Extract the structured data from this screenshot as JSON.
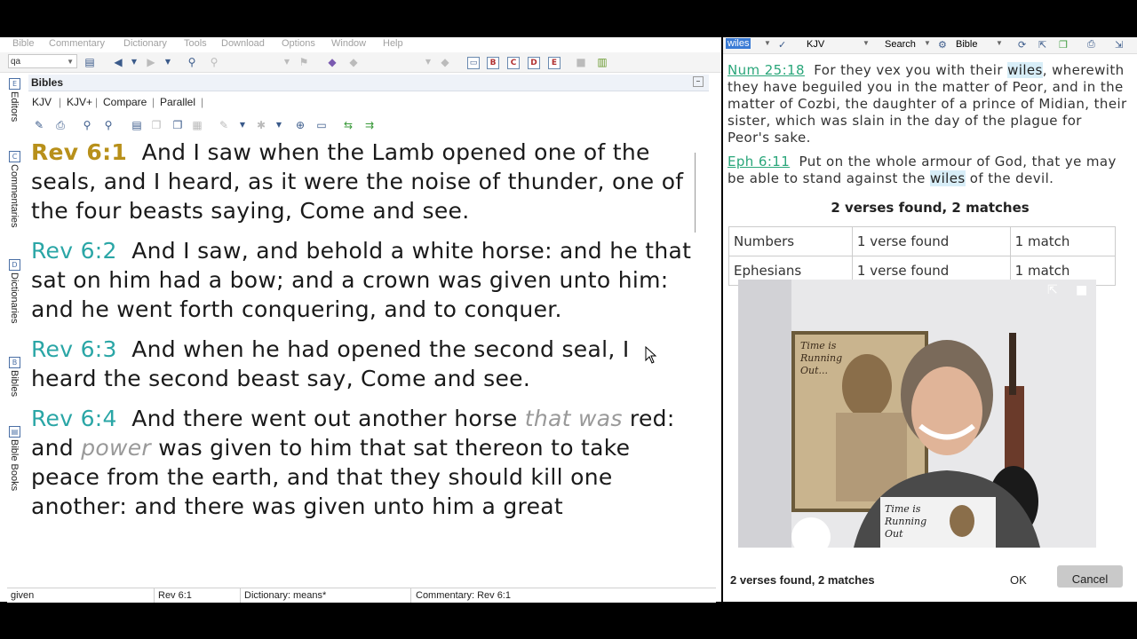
{
  "menu": [
    "Bible",
    "Commentary",
    "Dictionary",
    "Tools",
    "Download",
    "Options",
    "Window",
    "Help"
  ],
  "toolbar": {
    "module_combo": "qa"
  },
  "sidebar_tabs": [
    "Editors",
    "Commentaries",
    "Dictionaries",
    "Bibles",
    "Bible Books"
  ],
  "panel": {
    "title": "Bibles"
  },
  "tabs": [
    "KJV",
    "KJV+",
    "Compare",
    "Parallel"
  ],
  "verses": [
    {
      "ref": "Rev 6:1",
      "segments": [
        {
          "t": "And I saw when the Lamb opened one of the seals, and I heard, as it were the noise of thunder, one of the four beasts saying, Come and see."
        }
      ]
    },
    {
      "ref": "Rev 6:2",
      "segments": [
        {
          "t": "And I saw, and behold a white horse: and he that sat on him had a bow; and a crown was given unto him: and he went forth conquering, and to conquer."
        }
      ]
    },
    {
      "ref": "Rev 6:3",
      "segments": [
        {
          "t": "And when he had opened the second seal, I heard the second beast say, Come and see."
        }
      ]
    },
    {
      "ref": "Rev 6:4",
      "segments": [
        {
          "t": "And there went out another horse "
        },
        {
          "t": "that was",
          "i": true
        },
        {
          "t": " red: and "
        },
        {
          "t": "power",
          "i": true
        },
        {
          "t": " was given to him that sat thereon to take peace from the earth, and that they should kill one another: and there was given unto him a great"
        }
      ]
    }
  ],
  "status": {
    "word": "given",
    "verse": "Rev 6:1",
    "dictionary": "Dictionary: means*",
    "commentary": "Commentary: Rev 6:1"
  },
  "search": {
    "term": "wiles",
    "bible": "KJV",
    "search_label": "Search",
    "scope": "Bible",
    "results": [
      {
        "ref": "Num 25:18",
        "before": "For they vex you with their ",
        "match": "wiles",
        "after": ", wherewith they have beguiled you in the matter of Peor, and in the matter of Cozbi, the daughter of a prince of Midian, their sister, which was slain in the day of the plague for Peor's sake."
      },
      {
        "ref": "Eph 6:11",
        "before": "Put on the whole armour of God, that ye may be able to stand against the ",
        "match": "wiles",
        "after": " of the devil."
      }
    ],
    "summary": "2 verses found, 2 matches",
    "table": [
      {
        "book": "Numbers",
        "verses": "1 verse found",
        "matches": "1 match"
      },
      {
        "book": "Ephesians",
        "verses": "1 verse found",
        "matches": "1 match"
      }
    ],
    "ok_label": "OK",
    "cancel_label": "Cancel"
  },
  "video": {
    "poster_text": "Time is Running Out...",
    "shirt_text": "Time is Running Out"
  }
}
